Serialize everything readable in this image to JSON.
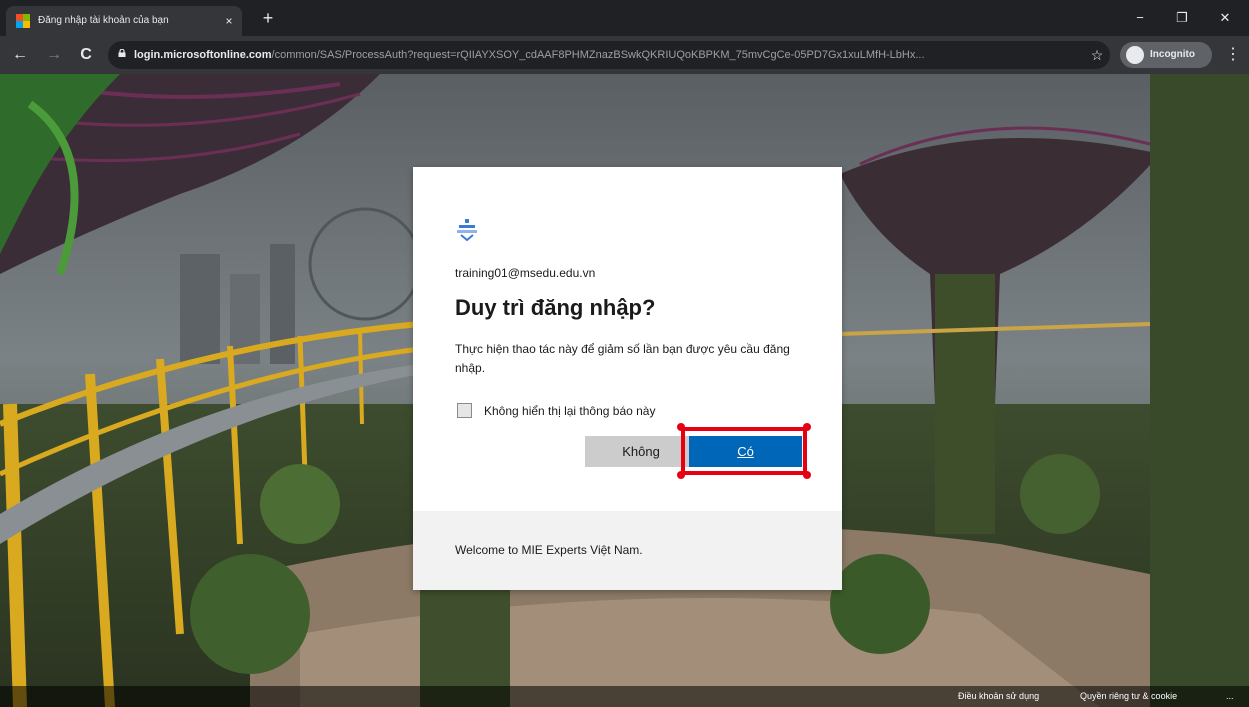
{
  "browser": {
    "tab_title": "Đăng nhập tài khoản của bạn",
    "tab_close": "×",
    "new_tab": "+",
    "minimize": "−",
    "restore": "❐",
    "close": "✕",
    "back": "←",
    "forward": "→",
    "reload": "C",
    "url_host": "login.microsoftonline.com",
    "url_path": "/common/SAS/ProcessAuth?request=rQIIAYXSOY_cdAAF8PHMZnazBSwkQKRIUQoKBPKM_75mvCgCe-05PD7Gx1xuLMfH-LbHx...",
    "bookmark_star": "☆",
    "profile_label": "Incognito",
    "menu": "⋮"
  },
  "dialog": {
    "email": "training01@msedu.edu.vn",
    "heading": "Duy trì đăng nhập?",
    "description": "Thực hiện thao tác này để giảm số lần bạn được yêu cầu đăng nhập.",
    "checkbox_label": "Không hiển thị lại thông báo này",
    "no_button": "Không",
    "yes_button": "Có",
    "footer": "Welcome to MIE Experts Việt Nam."
  },
  "page_footer": {
    "terms": "Điều khoản sử dụng",
    "privacy": "Quyền riêng tư & cookie",
    "more": "..."
  },
  "colors": {
    "accent": "#0067b8",
    "highlight": "#e60012"
  }
}
